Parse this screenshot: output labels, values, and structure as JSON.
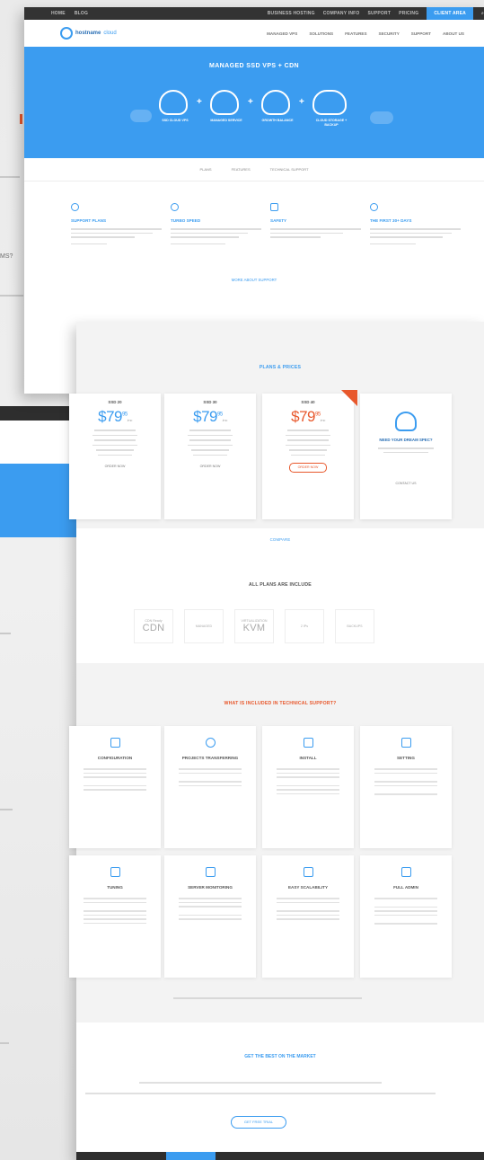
{
  "background": {
    "question_fragment": "MS?"
  },
  "back_page": {
    "top_bar": {
      "left_links": [
        "HOME",
        "BLOG"
      ],
      "right_links": [
        "BUSINESS HOSTING",
        "COMPANY INFO",
        "SUPPORT",
        "PRICING"
      ],
      "highlight": "CLIENT AREA"
    },
    "logo": {
      "name": "hostname",
      "suffix": "cloud"
    },
    "nav_links": [
      "MANAGED VPS",
      "SOLUTIONS",
      "FEATURES",
      "SECURITY",
      "SUPPORT",
      "ABOUT US"
    ],
    "hero": {
      "title": "MANAGED SSD VPS + CDN",
      "subtitle": "",
      "steps": [
        {
          "label": "SSD CLOUD VPS"
        },
        {
          "label": "MANAGED SERVICE"
        },
        {
          "label": "GROWTH BALANCE"
        },
        {
          "label": "CLOUD STORAGE + BACKUP"
        }
      ]
    },
    "tabs": [
      "PLANS",
      "FEATURES",
      "TECHNICAL SUPPORT"
    ],
    "features": [
      {
        "title": "SUPPORT PLANS"
      },
      {
        "title": "TURBO SPEED"
      },
      {
        "title": "SAFETY"
      },
      {
        "title": "THE FIRST 30+ DAYS"
      }
    ],
    "more_link": "MORE ABOUT SUPPORT"
  },
  "front_page": {
    "plans_title": "PLANS & PRICES",
    "plans": [
      {
        "name": "SSD 20",
        "price": "$79",
        "cents": "95",
        "period": "/mo",
        "button": "ORDER NOW"
      },
      {
        "name": "SSD 30",
        "price": "$79",
        "cents": "95",
        "period": "/mo",
        "button": "ORDER NOW"
      },
      {
        "name": "SSD 40",
        "price": "$79",
        "cents": "95",
        "period": "/mo",
        "button": "ORDER NOW",
        "featured": true
      },
      {
        "name": "NEED YOUR DREAM SPEC?",
        "button": "CONTACT US"
      }
    ],
    "compare_link": "COMPARE",
    "includes_title": "ALL PLANS ARE INCLUDE",
    "includes": [
      {
        "big": "CDN",
        "small": "CDN Ready"
      },
      {
        "big": "",
        "small": "MANAGED"
      },
      {
        "big": "KVM",
        "small": "VIRTUALIZATION"
      },
      {
        "big": "",
        "small": "2 IPs"
      },
      {
        "big": "",
        "small": "BACKUPS"
      }
    ],
    "support_title": "WHAT IS INCLUDED IN TECHNICAL SUPPORT?",
    "support_cards": [
      {
        "title": "CONFIGURATION"
      },
      {
        "title": "PROJECTS TRANSFERRING"
      },
      {
        "title": "INSTALL"
      },
      {
        "title": "SETTING"
      },
      {
        "title": "TUNING"
      },
      {
        "title": "SERVER MONITORING"
      },
      {
        "title": "EASY SCALABILITY"
      },
      {
        "title": "FULL ADMIN"
      }
    ],
    "bottom_title": "GET THE BEST ON THE MARKET",
    "bottom_button": "GET FREE TRIAL"
  }
}
